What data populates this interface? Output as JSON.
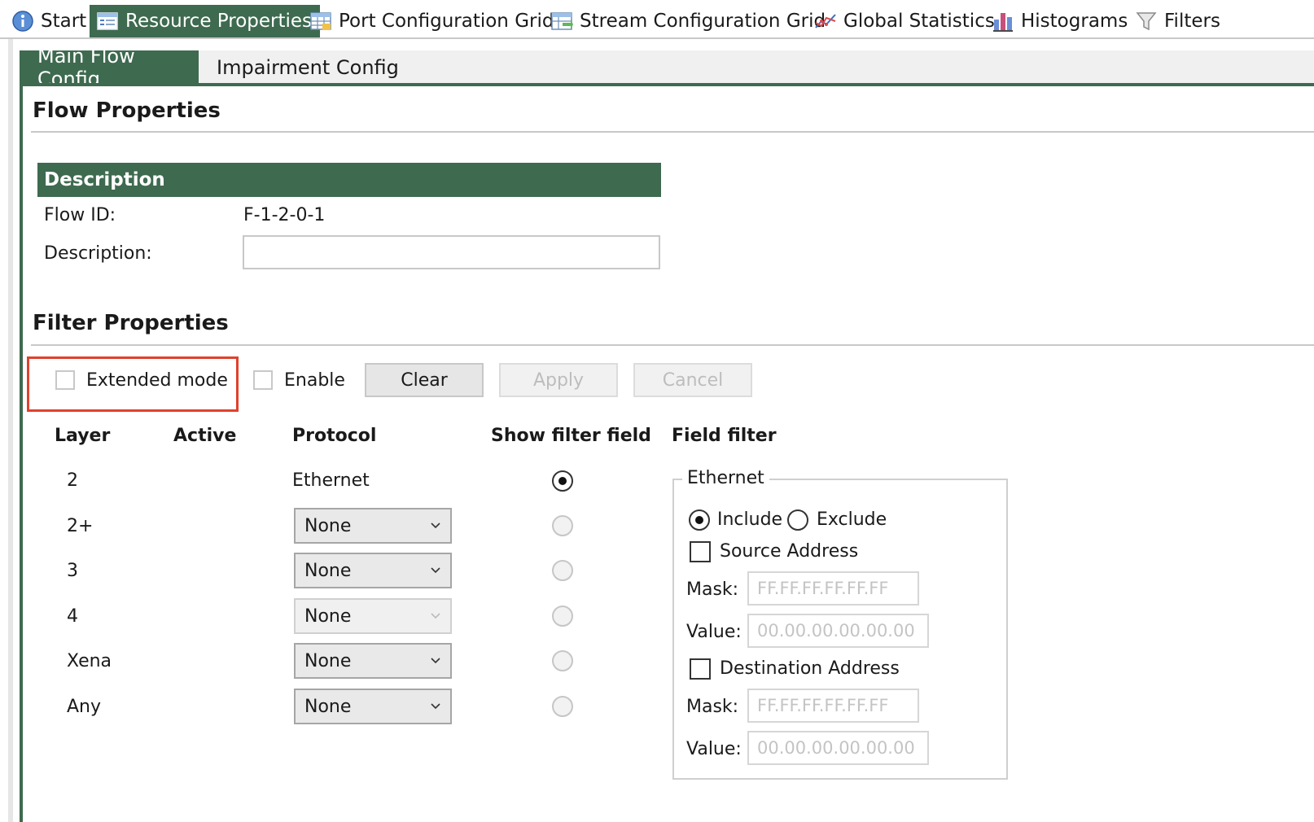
{
  "toolbar": {
    "items": [
      {
        "label": "Start",
        "icon": "info-icon"
      },
      {
        "label": "Resource Properties",
        "icon": "properties-icon"
      },
      {
        "label": "Port Configuration Grid",
        "icon": "grid-icon"
      },
      {
        "label": "Stream Configuration Grid",
        "icon": "stream-grid-icon"
      },
      {
        "label": "Global Statistics",
        "icon": "line-chart-icon"
      },
      {
        "label": "Histograms",
        "icon": "bar-chart-icon"
      },
      {
        "label": "Filters",
        "icon": "filter-icon"
      }
    ]
  },
  "subtabs": [
    {
      "label": "Main Flow Config",
      "active": true
    },
    {
      "label": "Impairment Config",
      "active": false
    }
  ],
  "flow": {
    "title": "Flow Properties",
    "description_header": "Description",
    "flow_id_label": "Flow ID:",
    "flow_id_value": "F-1-2-0-1",
    "description_label": "Description:",
    "description_value": ""
  },
  "filter": {
    "title": "Filter Properties",
    "extended_mode_label": "Extended mode",
    "extended_mode_checked": false,
    "enable_label": "Enable",
    "enable_checked": false,
    "clear_label": "Clear",
    "apply_label": "Apply",
    "cancel_label": "Cancel",
    "columns": {
      "layer": "Layer",
      "active": "Active",
      "protocol": "Protocol",
      "show_filter_field": "Show filter field",
      "field_filter": "Field filter"
    },
    "rows": [
      {
        "layer": "2",
        "protocol": "Ethernet",
        "selected": true
      },
      {
        "layer": "2+",
        "protocol": "None",
        "selected": false
      },
      {
        "layer": "3",
        "protocol": "None",
        "selected": false
      },
      {
        "layer": "4",
        "protocol": "None",
        "selected": false
      },
      {
        "layer": "Xena",
        "protocol": "None",
        "selected": false
      },
      {
        "layer": "Any",
        "protocol": "None",
        "selected": false
      }
    ]
  },
  "field_filter": {
    "group_label": "Ethernet",
    "include_label": "Include",
    "exclude_label": "Exclude",
    "mode": "Include",
    "source_label": "Source Address",
    "source_checked": false,
    "source_mask_label": "Mask:",
    "source_mask_placeholder": "FF.FF.FF.FF.FF.FF",
    "source_value_label": "Value:",
    "source_value_placeholder": "00.00.00.00.00.00",
    "dest_label": "Destination Address",
    "dest_checked": false,
    "dest_mask_label": "Mask:",
    "dest_mask_placeholder": "FF.FF.FF.FF.FF.FF",
    "dest_value_label": "Value:",
    "dest_value_placeholder": "00.00.00.00.00.00"
  },
  "colors": {
    "accent": "#3e6a4f",
    "highlight": "#e0412d"
  }
}
